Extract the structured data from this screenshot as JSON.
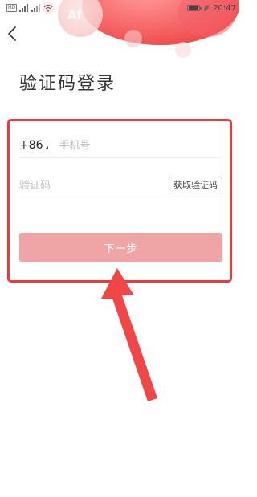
{
  "status_bar": {
    "hd_badge": "HD",
    "battery_level": "77",
    "time": "20:47"
  },
  "header": {
    "decoration_text": "AI"
  },
  "page": {
    "title": "验证码登录"
  },
  "form": {
    "country_code": "+86",
    "phone_placeholder": "手机号",
    "code_placeholder": "验证码",
    "get_code_label": "获取验证码",
    "next_label": "下一步"
  },
  "colors": {
    "accent": "#f03a3a",
    "button_disabled": "#efa5a5",
    "decoration": "#f44b4b"
  }
}
